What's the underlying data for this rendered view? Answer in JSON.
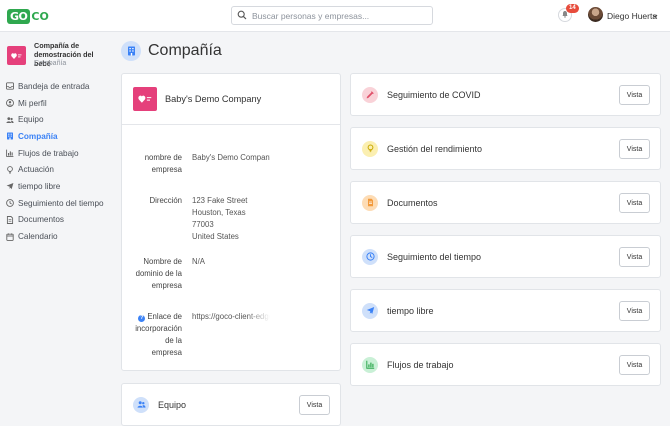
{
  "header": {
    "logo_left": "GO",
    "logo_right": "CO",
    "search_placeholder": "Buscar personas y empresas...",
    "notification_count": "14",
    "user_name": "Diego Huerta"
  },
  "sidebar": {
    "company_name": "Compañía de demostración del bebé",
    "company_sub": "Compañía",
    "items": [
      {
        "label": "Bandeja de entrada",
        "icon": "inbox-icon"
      },
      {
        "label": "Mi perfil",
        "icon": "profile-icon"
      },
      {
        "label": "Equipo",
        "icon": "team-icon"
      },
      {
        "label": "Compañía",
        "icon": "company-icon",
        "active": true
      },
      {
        "label": "Flujos de trabajo",
        "icon": "workflow-icon"
      },
      {
        "label": "Actuación",
        "icon": "performance-icon"
      },
      {
        "label": "tiempo libre",
        "icon": "plane-icon"
      },
      {
        "label": "Seguimiento del tiempo",
        "icon": "clock-icon"
      },
      {
        "label": "Documentos",
        "icon": "document-icon"
      },
      {
        "label": "Calendario",
        "icon": "calendar-icon"
      }
    ]
  },
  "page": {
    "title": "Compañía"
  },
  "company_info": {
    "name": "Baby's Demo Company",
    "fields": {
      "name_label_1": "nombre de",
      "name_label_2": "empresa",
      "name_value": "Baby's Demo Company",
      "address_label": "Dirección",
      "address_lines": [
        "123 Fake Street",
        "Houston, Texas",
        "77003",
        "United States"
      ],
      "domain_label_1": "Nombre de",
      "domain_label_2": "dominio de la",
      "domain_label_3": "empresa",
      "domain_value": "N/A",
      "link_label_1": "Enlace de",
      "link_label_2": "incorporación",
      "link_label_3": "de la",
      "link_label_4": "empresa",
      "link_value": "https://goco-client-edge"
    }
  },
  "team_card": {
    "label": "Equipo",
    "button": "Vista"
  },
  "modules": [
    {
      "label": "Seguimiento de COVID",
      "button": "Vista",
      "icon": "syringe-icon",
      "color": "#f9d2d8"
    },
    {
      "label": "Gestión del rendimiento",
      "button": "Vista",
      "icon": "lightbulb-icon",
      "color": "#fbefb1"
    },
    {
      "label": "Documentos",
      "button": "Vista",
      "icon": "document-icon",
      "color": "#fddcb5"
    },
    {
      "label": "Seguimiento del tiempo",
      "button": "Vista",
      "icon": "clock-icon",
      "color": "#cfe0fa"
    },
    {
      "label": "tiempo libre",
      "button": "Vista",
      "icon": "plane-icon",
      "color": "#cfe0fa"
    },
    {
      "label": "Flujos de trabajo",
      "button": "Vista",
      "icon": "workflow-icon",
      "color": "#c9f0d6"
    }
  ],
  "colors": {
    "accent": "#3b82f6",
    "brand": "#2fa84f",
    "company_logo": "#e5407b"
  }
}
